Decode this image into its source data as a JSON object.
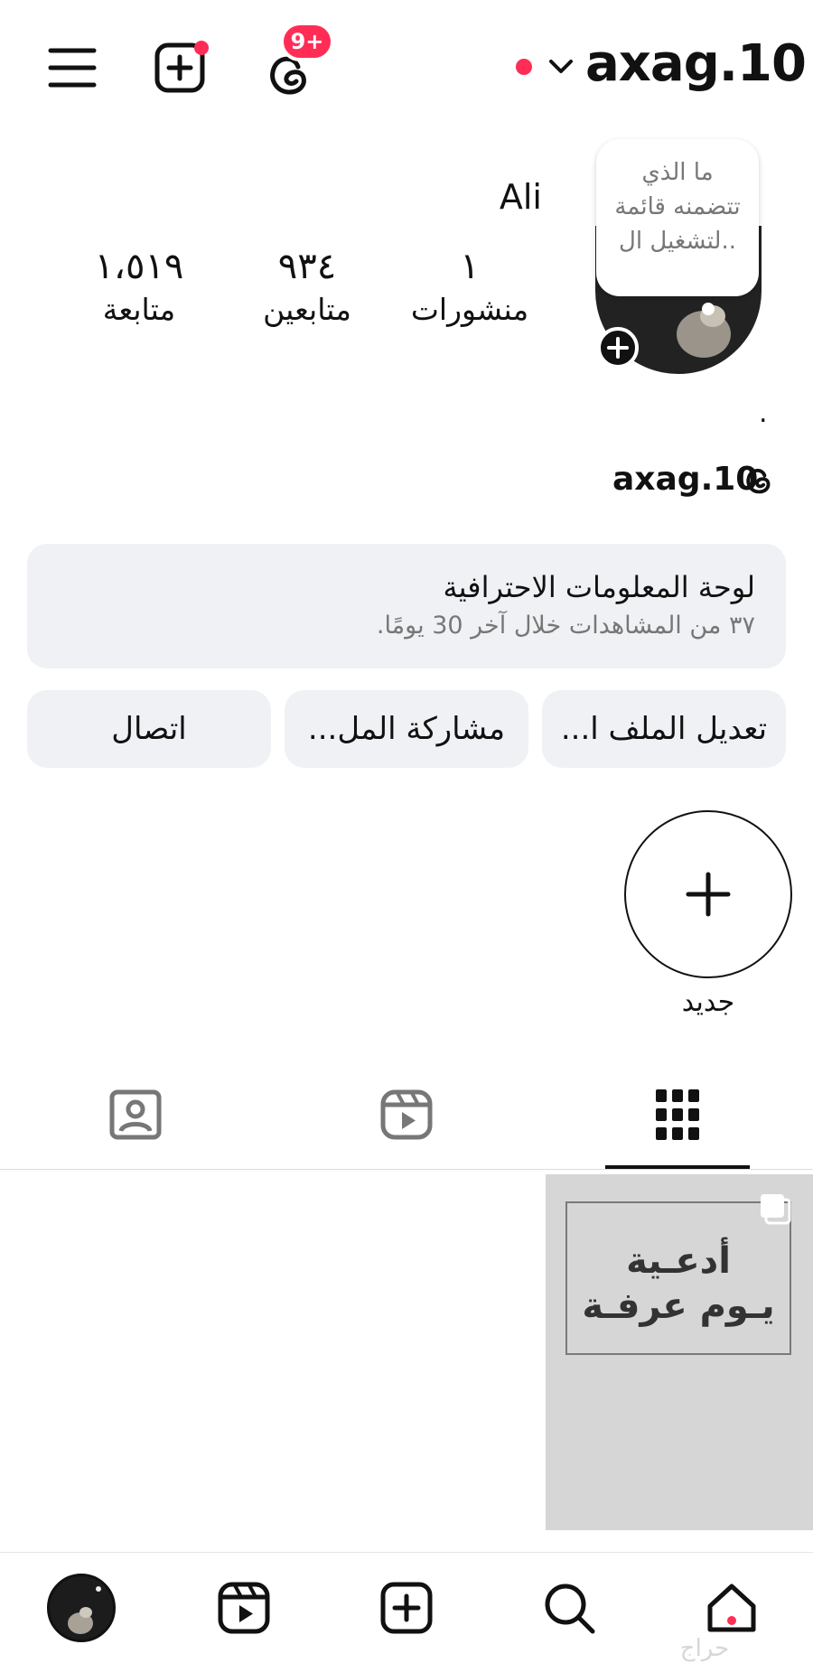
{
  "header": {
    "username": "axag.10",
    "notification_badge": "9+",
    "accent_red": "#ff2d55"
  },
  "profile": {
    "name": "Ali",
    "note_bubble": "ما الذي تتضمنه قائمة لتشغيل ال..",
    "dot_text": ".",
    "threads_handle": "axag.10",
    "stats": [
      {
        "value": "١",
        "label": "منشورات"
      },
      {
        "value": "٩٣٤",
        "label": "متابعين"
      },
      {
        "value": "١،٥١٩",
        "label": "متابعة"
      }
    ]
  },
  "dashboard": {
    "title": "لوحة المعلومات الاحترافية",
    "subtitle": "٣٧ من المشاهدات خلال آخر 30 يومًا."
  },
  "actions": {
    "edit": "تعديل الملف ا...",
    "share": "مشاركة المل...",
    "contact": "اتصال"
  },
  "highlights": {
    "new_label": "جديد"
  },
  "post": {
    "line1": "أدعـية",
    "line2": "يـوم عرفـة"
  },
  "watermark": "حراج"
}
